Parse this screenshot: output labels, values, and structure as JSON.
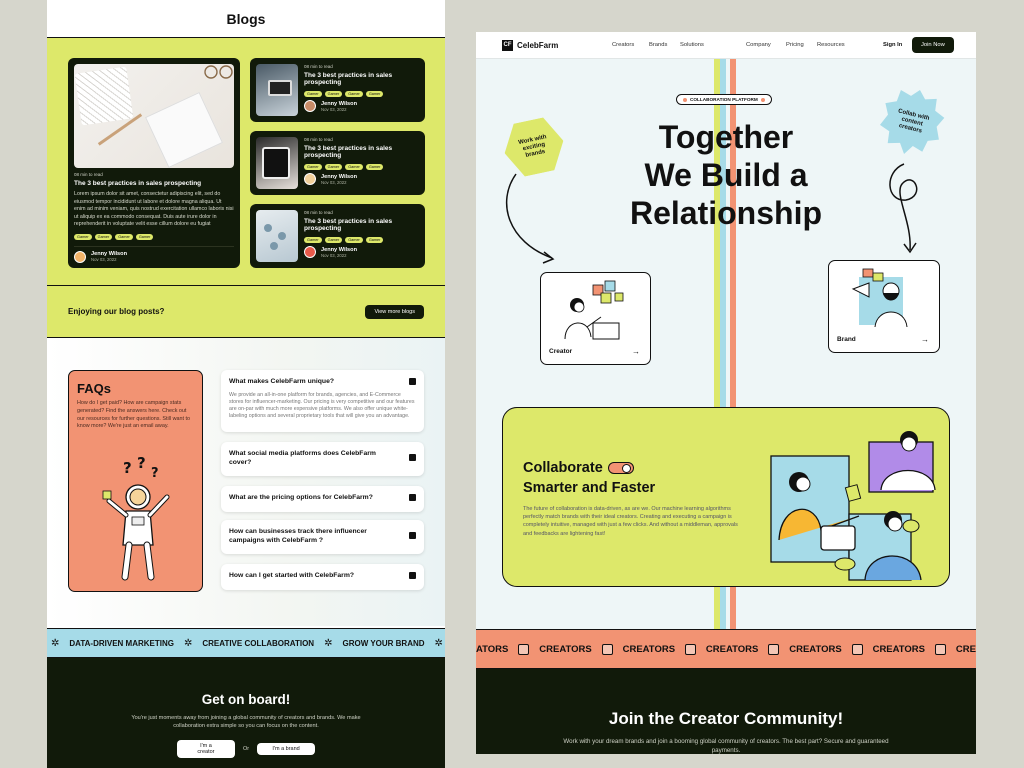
{
  "left": {
    "blogs_title": "Blogs",
    "featured": {
      "meta": "08 min to read",
      "title": "The 3 best practices in sales prospecting",
      "description": "Lorem ipsum dolor sit amet, consectetur adipiscing elit, sed do eiusmod tempor incididunt ut labore et dolore magna aliqua. Ut enim ad minim veniam, quis nostrud exercitation ullamco laboris nisi ut aliquip ex ea commodo consequat. Duis aute irure dolor in reprehenderit in voluptate velit esse cillum dolore eu fugiat",
      "tags": [
        "Gamer",
        "Gamer",
        "Gamer",
        "Gamer"
      ],
      "author": "Jenny Wilson",
      "date": "Nov 03, 2022"
    },
    "cards": [
      {
        "meta": "08 min to read",
        "title": "The 3 best practices in sales prospecting",
        "tags": [
          "Gamer",
          "Gamer",
          "Gamer",
          "Gamer"
        ],
        "author": "Jenny Wilson",
        "date": "Nov 03, 2022"
      },
      {
        "meta": "08 min to read",
        "title": "The 3 best practices in sales prospecting",
        "tags": [
          "Gamer",
          "Gamer",
          "Gamer",
          "Gamer"
        ],
        "author": "Jenny Wilson",
        "date": "Nov 03, 2022"
      },
      {
        "meta": "08 min to read",
        "title": "The 3 best practices in sales prospecting",
        "tags": [
          "Gamer",
          "Gamer",
          "Gamer",
          "Gamer"
        ],
        "author": "Jenny Wilson",
        "date": "Nov 03, 2022"
      }
    ],
    "enjoy_text": "Enjoying our blog posts?",
    "view_more": "View more blogs",
    "faq_title": "FAQs",
    "faq_desc": "How do I get paid? How are campaign stats generated? Find the answers here. Check out our resources for further questions. Still want to know more? We're just an email away.",
    "questions": [
      {
        "q": "What makes CelebFarm unique?",
        "a": "We provide an all-in-one platform for brands, agencies, and E-Commerce stores for influencer-marketing. Our pricing is very competitive and our features are on-par with much more expensive platforms. We also offer unique white-labeling options and several proprietary tools that will give you an advantage."
      },
      {
        "q": "What social media platforms does CelebFarm cover?",
        "a": ""
      },
      {
        "q": "What are the pricing options for CelebFarm?",
        "a": ""
      },
      {
        "q": "How can businesses track there influencer campaigns with CelebFarm ?",
        "a": ""
      },
      {
        "q": "How can I get started with CelebFarm?",
        "a": ""
      }
    ],
    "ticker": [
      "DATA-DRIVEN MARKETING",
      "CREATIVE COLLABORATION",
      "GROW YOUR BRAND"
    ],
    "onboard_title": "Get on board!",
    "onboard_text": "You're just moments away from joining a global community of creators and brands. We make collaboration extra simple so you can focus on the content.",
    "btn_creator": "I'm a creator",
    "or": "Or",
    "btn_brand": "I'm a brand"
  },
  "right": {
    "logo": "CelebFarm",
    "logo_mark": "CF",
    "nav": [
      "Creators",
      "Brands",
      "Solutions",
      "Company",
      "Pricing",
      "Resources"
    ],
    "sign_in": "Sign In",
    "join_now": "Join Now",
    "platform_tag": "COLLABORATION PLATFORM",
    "hero_line1": "Together",
    "hero_line2": "We Build a",
    "hero_line3": "Relationship",
    "hex_text": "Work with exciting brands",
    "star_text": "Collab with content creators",
    "creator_label": "Creator",
    "brand_label": "Brand",
    "arrow": "→",
    "collab_line1": "Collaborate",
    "collab_line2": "Smarter and Faster",
    "collab_desc": "The future of collaboration is data-driven, as are we. Our machine learning algorithms perfectly match brands with their ideal creators. Creating and executing a campaign is completely intuitive, managed with just a few clicks. And without a middleman, approvals and feedbacks are lightening fast!",
    "ticker_word": "CREATORS",
    "ticker_edge_left": "ATORS",
    "ticker_edge_right": "CRE",
    "join_title": "Join the Creator Community!",
    "join_text": "Work with your dream brands and join a booming global community of creators. The best part? Secure and guaranteed payments."
  },
  "colors": {
    "lime": "#dde86a",
    "salmon": "#f29373",
    "sky": "#a6dbe8",
    "dark": "#111a0a"
  }
}
